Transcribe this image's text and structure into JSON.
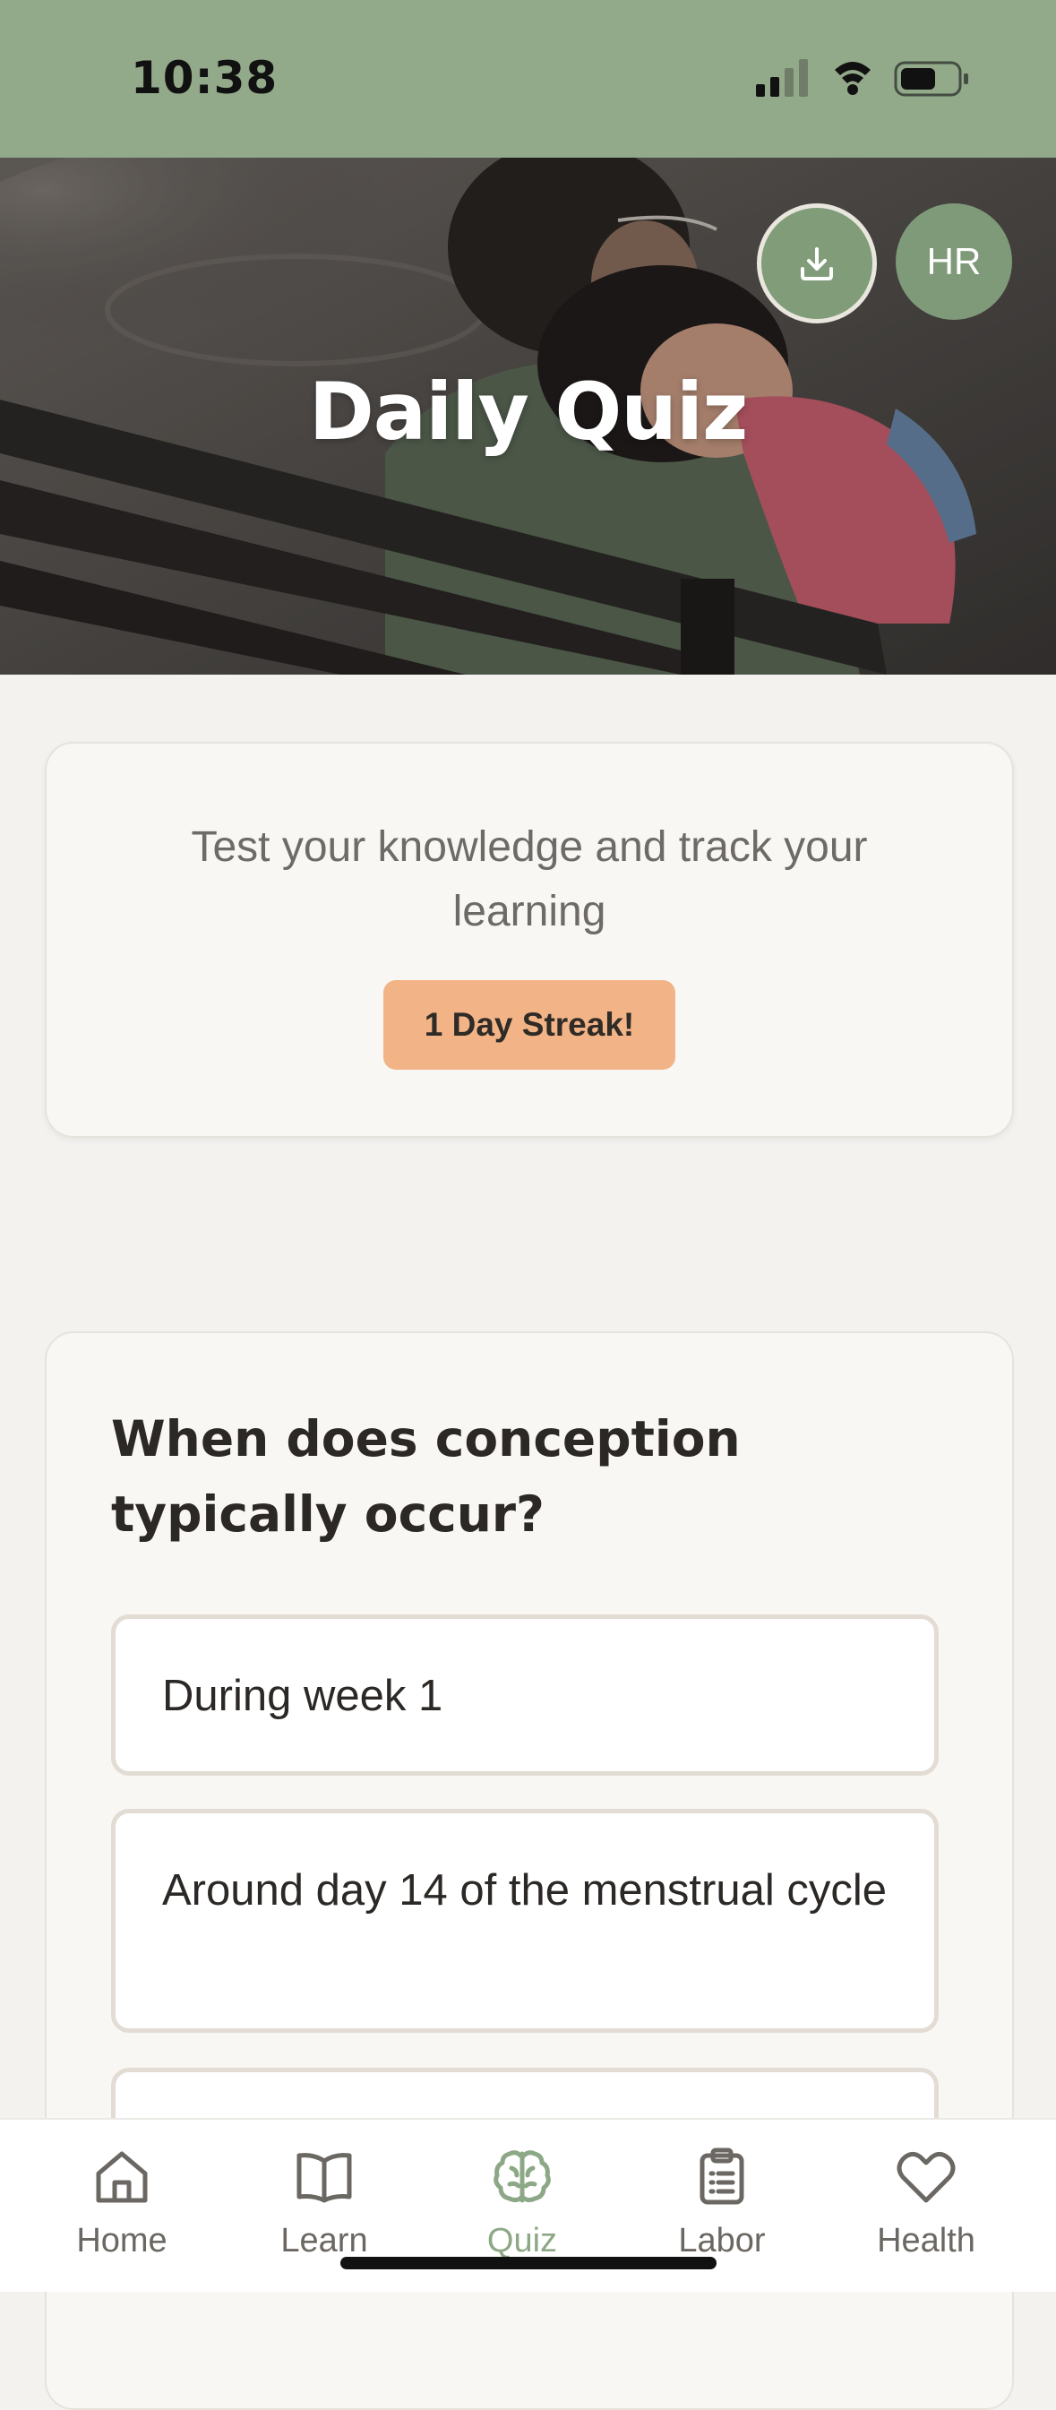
{
  "status_bar": {
    "time": "10:38"
  },
  "hero": {
    "title": "Daily Quiz",
    "avatar_initials": "HR"
  },
  "intro": {
    "subtitle": "Test your knowledge and track your learning",
    "streak_label": "1 Day Streak!"
  },
  "quiz": {
    "question": "When does conception typically occur?",
    "options": [
      "During week 1",
      "Around day 14 of the menstrual cycle",
      ""
    ]
  },
  "nav": {
    "items": [
      {
        "label": "Home",
        "icon": "home-icon"
      },
      {
        "label": "Learn",
        "icon": "book-icon"
      },
      {
        "label": "Quiz",
        "icon": "brain-icon",
        "active": true
      },
      {
        "label": "Labor",
        "icon": "clipboard-icon"
      },
      {
        "label": "Health",
        "icon": "heart-icon"
      }
    ]
  },
  "colors": {
    "status_bar": "#92A98A",
    "accent_green": "#8DA886",
    "streak_badge": "#F2B487",
    "background": "#F3F2EF"
  }
}
